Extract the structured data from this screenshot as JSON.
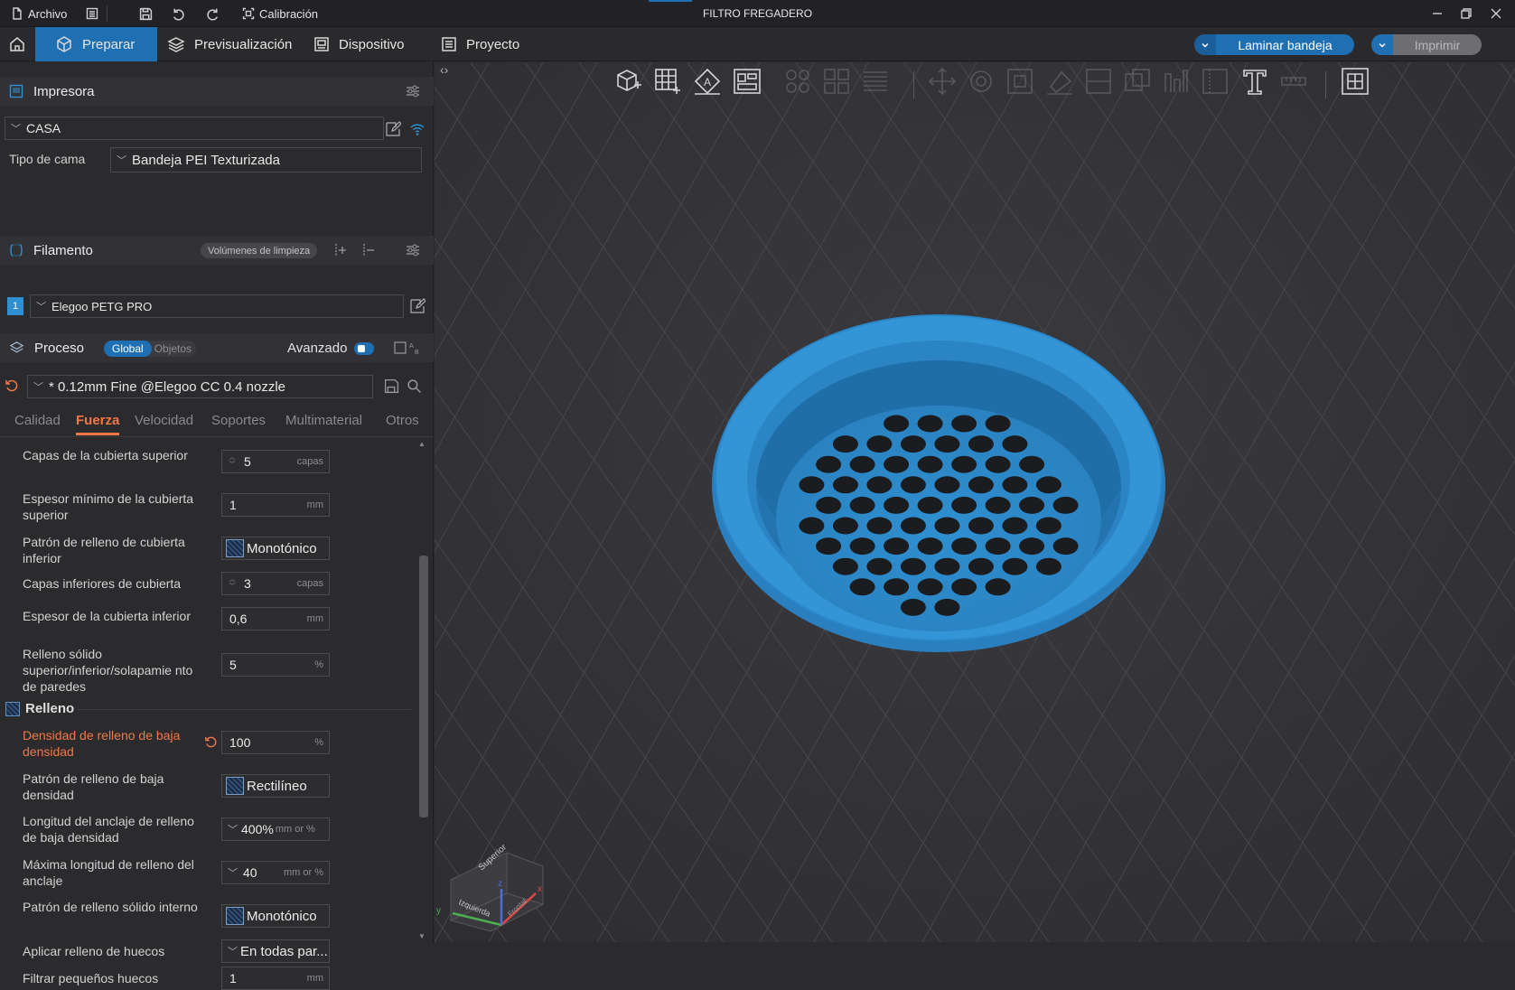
{
  "titlebar": {
    "file_label": "Archivo",
    "calibration_label": "Calibración",
    "window_title": "FILTRO FREGADERO"
  },
  "tabs": {
    "prepare": "Preparar",
    "preview": "Previsualización",
    "device": "Dispositivo",
    "project": "Proyecto"
  },
  "actions": {
    "slice_label": "Laminar bandeja",
    "print_label": "Imprimir"
  },
  "printer": {
    "section_title": "Impresora",
    "printer_name": "CASA",
    "bed_type_label": "Tipo de cama",
    "bed_type_value": "Bandeja PEI Texturizada"
  },
  "filament": {
    "section_title": "Filamento",
    "flush_volumes_label": "Volúmenes de limpieza",
    "slot_number": "1",
    "filament_name": "Elegoo PETG PRO"
  },
  "process": {
    "section_title": "Proceso",
    "scope_global": "Global",
    "scope_objects": "Objetos",
    "advanced_label": "Avanzado",
    "profile_name": "* 0.12mm Fine @Elegoo CC 0.4 nozzle",
    "subtabs": [
      "Calidad",
      "Fuerza",
      "Velocidad",
      "Soportes",
      "Multimaterial",
      "Otros"
    ]
  },
  "settings": [
    {
      "label": "Capas de la cubierta superior",
      "value": "5",
      "unit": "capas"
    },
    {
      "label": "Espesor mínimo de la cubierta superior",
      "value": "1",
      "unit": "mm"
    },
    {
      "label": "Patrón de relleno de cubierta inferior",
      "value": "Monotónico",
      "unit": ""
    },
    {
      "label": "Capas inferiores de cubierta",
      "value": "3",
      "unit": "capas"
    },
    {
      "label": "Espesor de la cubierta inferior",
      "value": "0,6",
      "unit": "mm"
    },
    {
      "label": "Relleno sólido superior/inferior/solapamie nto de paredes",
      "value": "5",
      "unit": "%"
    }
  ],
  "infill": {
    "section_title": "Relleno",
    "settings": [
      {
        "label": "Densidad de relleno de baja densidad",
        "value": "100",
        "unit": "%"
      },
      {
        "label": "Patrón de relleno de baja densidad",
        "value": "Rectilíneo",
        "unit": ""
      },
      {
        "label": "Longitud del anclaje de relleno de baja densidad",
        "value": "400%",
        "unit": "mm or %"
      },
      {
        "label": "Máxima longitud de relleno del anclaje",
        "value": "40",
        "unit": "mm or %"
      },
      {
        "label": "Patrón de relleno sólido interno",
        "value": "Monotónico",
        "unit": ""
      },
      {
        "label": "Aplicar relleno de huecos",
        "value": "En todas par...",
        "unit": ""
      },
      {
        "label": "Filtrar pequeños huecos",
        "value": "1",
        "unit": "mm"
      }
    ]
  },
  "viewport": {
    "gizmo_top": "Superior",
    "gizmo_left": "Izquierda",
    "gizmo_front": "Frontal",
    "axis_x": "x",
    "axis_y": "y",
    "axis_z": "z"
  },
  "colors": {
    "accent": "#1f6fb3",
    "modified": "#f07848",
    "model": "#2f8fd0"
  }
}
